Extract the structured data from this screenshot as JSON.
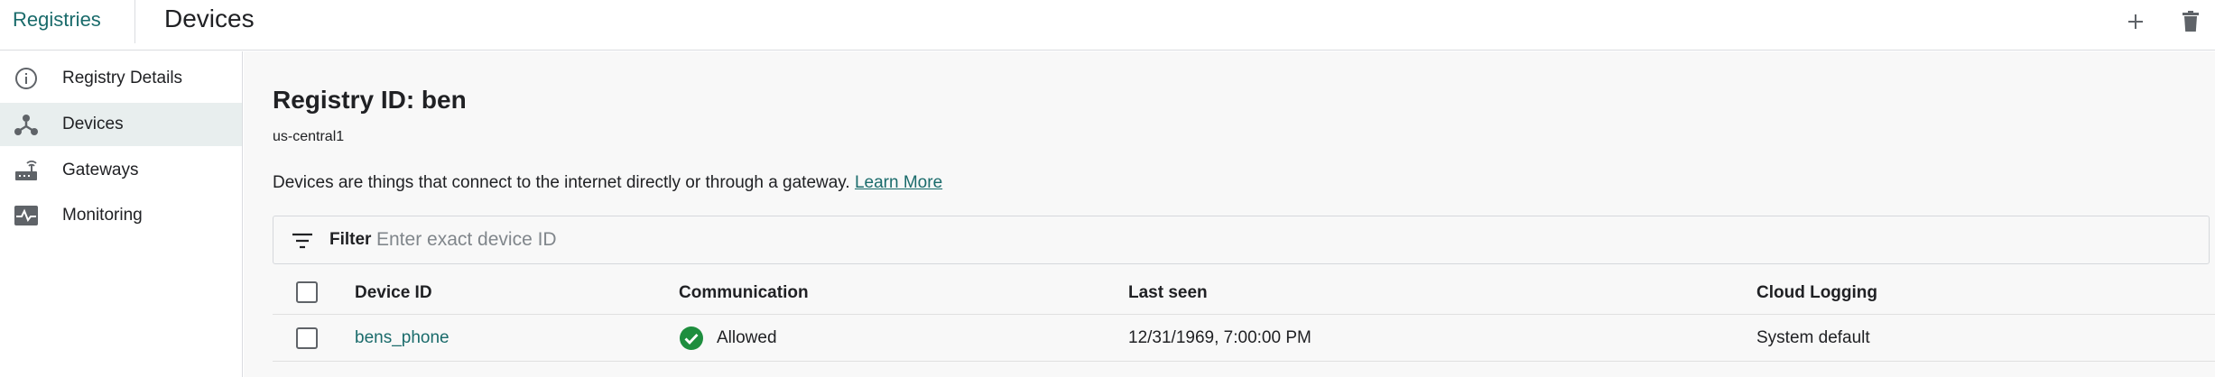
{
  "header": {
    "breadcrumb": "Registries",
    "title": "Devices",
    "add_icon": "plus-icon",
    "delete_icon": "trash-icon"
  },
  "sidebar": {
    "items": [
      {
        "label": "Registry Details",
        "icon": "info-icon",
        "active": false
      },
      {
        "label": "Devices",
        "icon": "device-hub-icon",
        "active": true
      },
      {
        "label": "Gateways",
        "icon": "router-icon",
        "active": false
      },
      {
        "label": "Monitoring",
        "icon": "monitoring-icon",
        "active": false
      }
    ]
  },
  "main": {
    "registry_title": "Registry ID: ben",
    "region": "us-central1",
    "description": "Devices are things that connect to the internet directly or through a gateway.",
    "learn_more": "Learn More",
    "filter": {
      "label": "Filter",
      "placeholder": "Enter exact device ID",
      "value": ""
    },
    "table": {
      "headers": [
        "Device ID",
        "Communication",
        "Last seen",
        "Cloud Logging"
      ],
      "rows": [
        {
          "device_id": "bens_phone",
          "communication": "Allowed",
          "last_seen": "12/31/1969, 7:00:00 PM",
          "cloud_logging": "System default"
        }
      ]
    }
  },
  "colors": {
    "accent": "#1a6b6b",
    "allowed": "#1e8e3e",
    "active_nav_bg": "#e8eeee"
  }
}
